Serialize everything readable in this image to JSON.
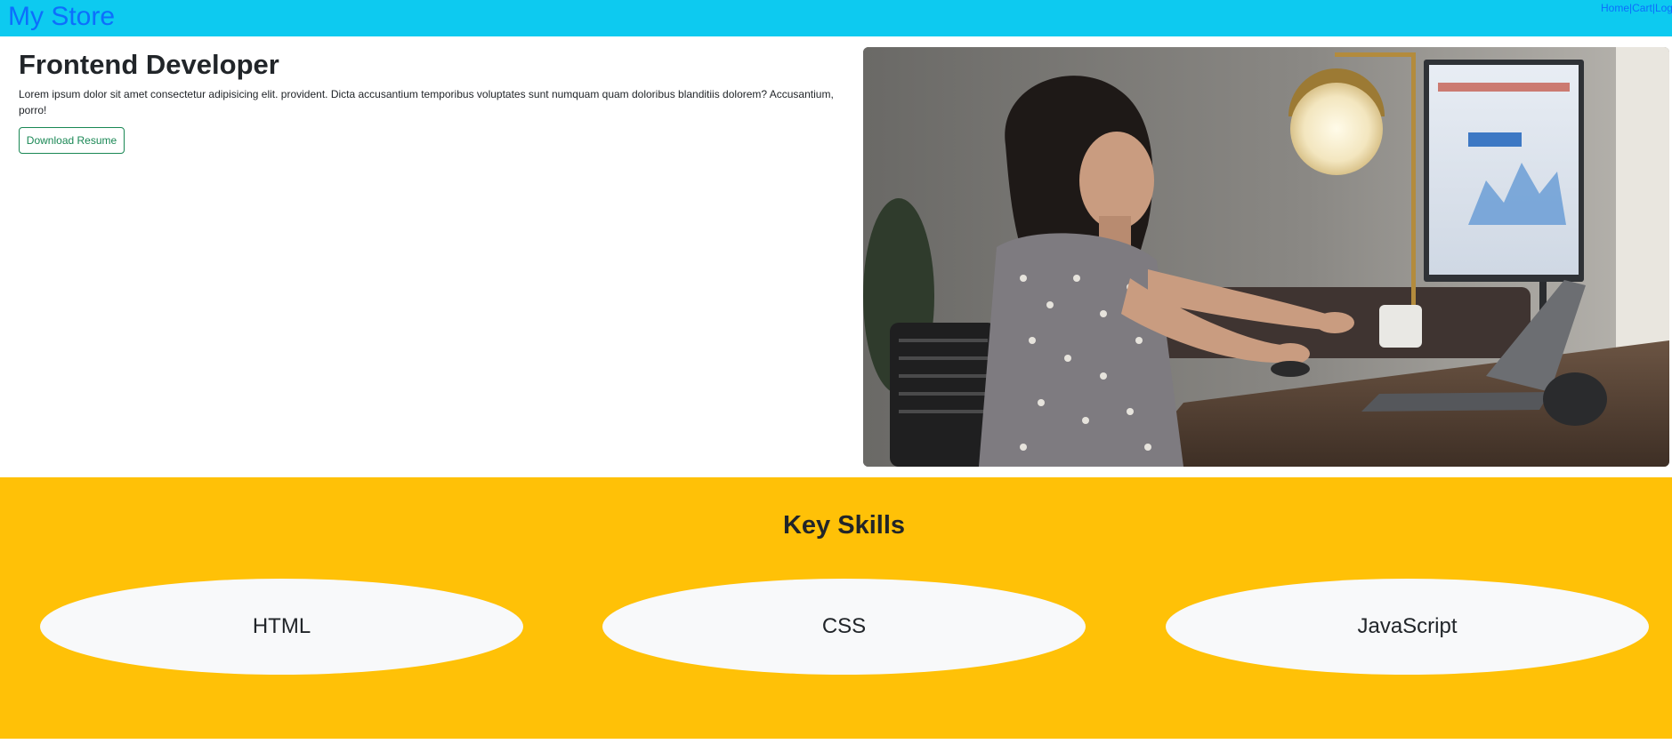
{
  "header": {
    "brand": "My Store",
    "nav": [
      {
        "label": "Home"
      },
      {
        "label": "Cart"
      },
      {
        "label": "Log"
      }
    ],
    "separator": "|"
  },
  "hero": {
    "title": "Frontend Developer",
    "text": "Lorem ipsum dolor sit amet consectetur adipisicing elit. provident. Dicta accusantium temporibus voluptates sunt numquam quam doloribus blanditiis dolorem? Accusantium, porro!",
    "button_label": "Download Resume",
    "image_description": "woman-working-at-laptop-photo"
  },
  "skills": {
    "title": "Key Skills",
    "items": [
      {
        "label": "HTML"
      },
      {
        "label": "CSS"
      },
      {
        "label": "JavaScript"
      }
    ]
  },
  "colors": {
    "topbar": "#0dcaf0",
    "brand": "#0d6efd",
    "button": "#198754",
    "skills_bg": "#ffc107",
    "pill_bg": "#f8f9fa"
  }
}
